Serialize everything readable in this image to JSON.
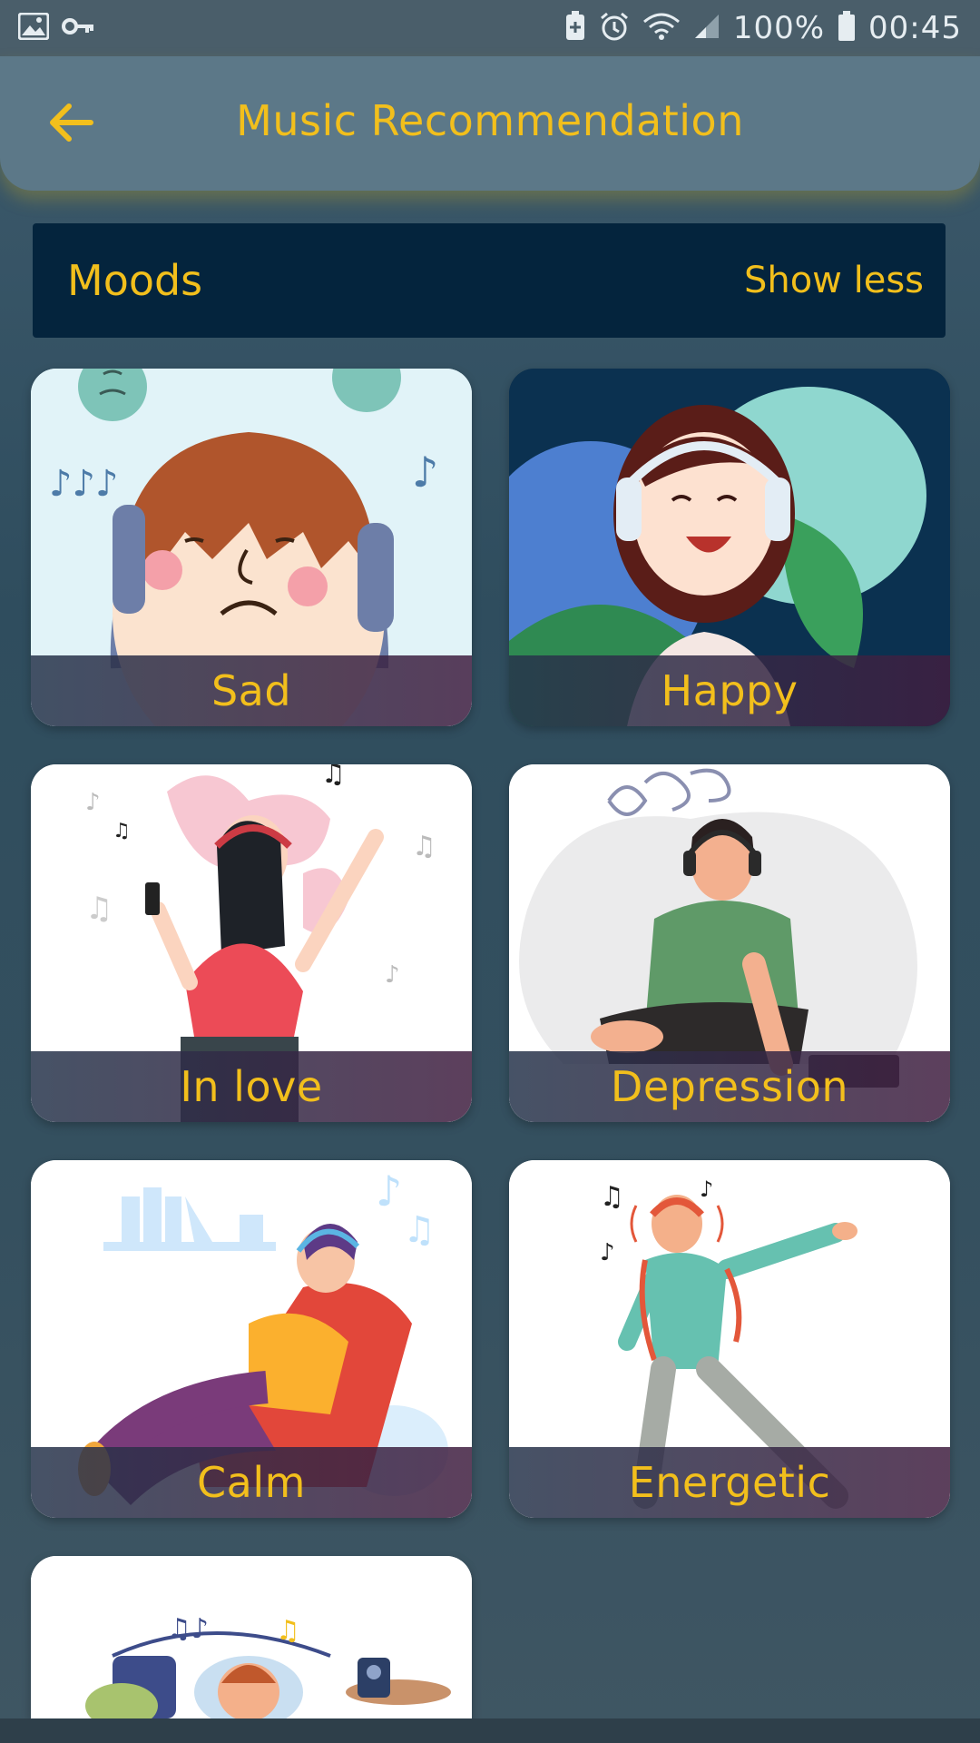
{
  "status_bar": {
    "battery": "100%",
    "time": "00:45",
    "left_icons": [
      "image-icon",
      "key-icon"
    ],
    "right_icons": [
      "battery-saver-icon",
      "alarm-icon",
      "wifi-icon",
      "signal-icon",
      "battery-icon"
    ]
  },
  "app_bar": {
    "title": "Music Recommendation",
    "back_icon": "arrow-left-icon"
  },
  "section": {
    "title": "Moods",
    "toggle_label": "Show less"
  },
  "moods": [
    {
      "label": "Sad"
    },
    {
      "label": "Happy"
    },
    {
      "label": "In love"
    },
    {
      "label": "Depression"
    },
    {
      "label": "Calm"
    },
    {
      "label": "Energetic"
    },
    {
      "label": ""
    }
  ],
  "colors": {
    "accent": "#f2bf1c",
    "app_bar": "#5c7888",
    "section_header": "#04243d",
    "background": "#35505f"
  }
}
